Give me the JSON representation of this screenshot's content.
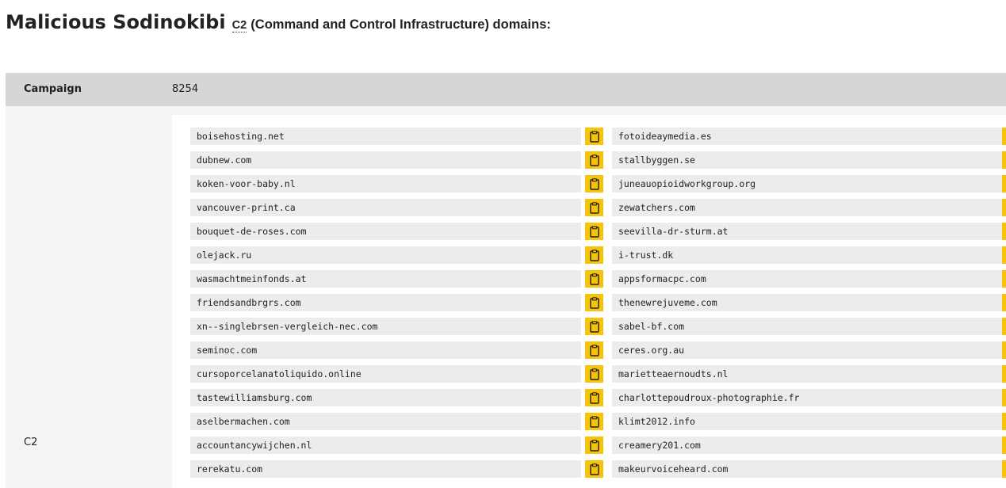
{
  "heading": {
    "main": "Malicious Sodinokibi",
    "abbr": "C2",
    "sub": "(Command and Control Infrastructure) domains:"
  },
  "campaign": {
    "label": "Campaign",
    "value": "8254"
  },
  "c2": {
    "label": "C2"
  },
  "domain_rows": [
    {
      "left": "boisehosting.net",
      "right": "fotoideaymedia.es"
    },
    {
      "left": "dubnew.com",
      "right": "stallbyggen.se"
    },
    {
      "left": "koken-voor-baby.nl",
      "right": "juneauopioidworkgroup.org"
    },
    {
      "left": "vancouver-print.ca",
      "right": "zewatchers.com"
    },
    {
      "left": "bouquet-de-roses.com",
      "right": "seevilla-dr-sturm.at"
    },
    {
      "left": "olejack.ru",
      "right": "i-trust.dk"
    },
    {
      "left": "wasmachtmeinfonds.at",
      "right": "appsformacpc.com"
    },
    {
      "left": "friendsandbrgrs.com",
      "right": "thenewrejuveme.com"
    },
    {
      "left": "xn--singlebrsen-vergleich-nec.com",
      "right": "sabel-bf.com"
    },
    {
      "left": "seminoc.com",
      "right": "ceres.org.au"
    },
    {
      "left": "cursoporcelanatoliquido.online",
      "right": "marietteaernoudts.nl"
    },
    {
      "left": "tastewilliamsburg.com",
      "right": "charlottepoudroux-photographie.fr"
    },
    {
      "left": "aselbermachen.com",
      "right": "klimt2012.info"
    },
    {
      "left": "accountancywijchen.nl",
      "right": "creamery201.com"
    },
    {
      "left": "rerekatu.com",
      "right": "makeurvoiceheard.com"
    }
  ],
  "icons": {
    "copy": "clipboard-icon"
  },
  "colors": {
    "copy_button": "#f7c40a",
    "header_row": "#d6d6d6",
    "cell_bg": "#ececec"
  }
}
